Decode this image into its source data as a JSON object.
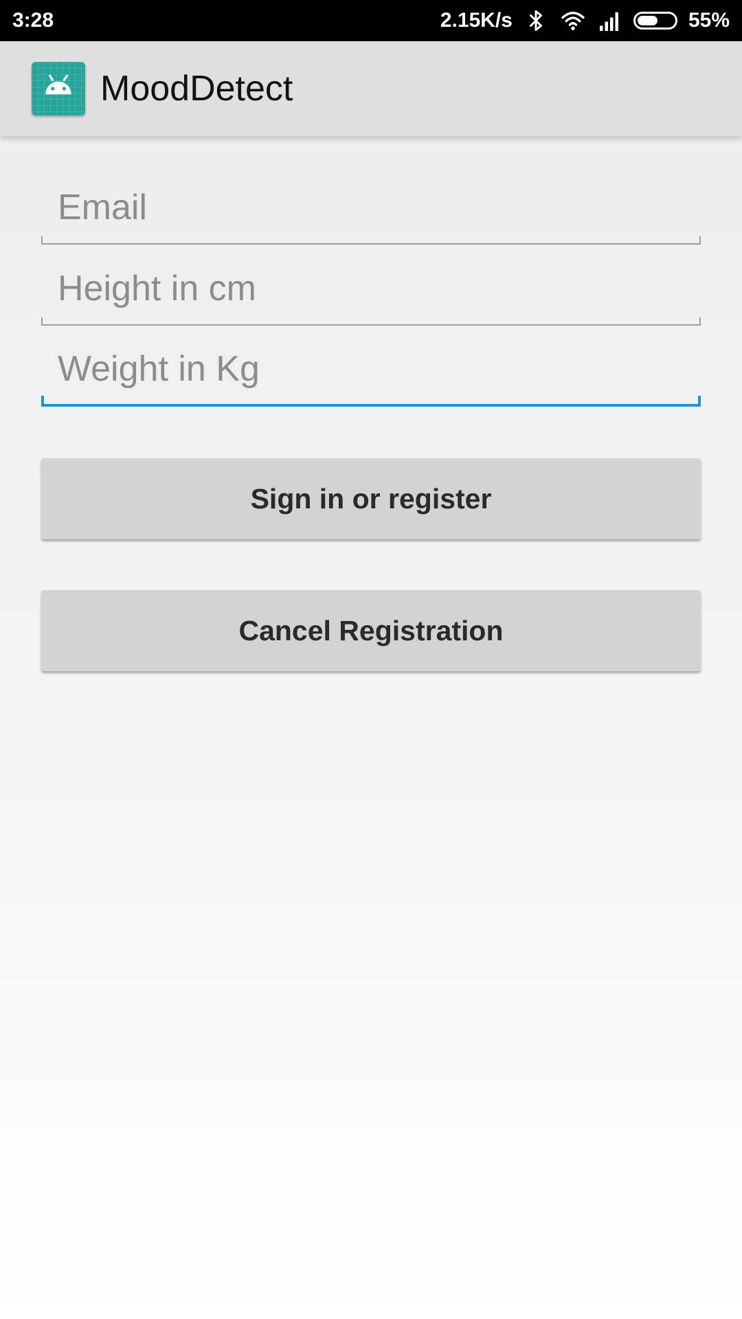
{
  "status_bar": {
    "time": "3:28",
    "network_speed": "2.15K/s",
    "battery_percent": "55%",
    "battery_level": 0.55,
    "icons": [
      "bluetooth-icon",
      "wifi-icon",
      "signal-icon",
      "battery-icon"
    ]
  },
  "app_bar": {
    "title": "MoodDetect",
    "icon": "android-icon",
    "icon_color": "#26a69a"
  },
  "form": {
    "email": {
      "value": "",
      "placeholder": "Email"
    },
    "height": {
      "value": "",
      "placeholder": "Height in cm"
    },
    "weight": {
      "value": "",
      "placeholder": "Weight in Kg",
      "focused": true
    },
    "focus_color": "#1e98d3"
  },
  "buttons": {
    "sign_in": "Sign in or register",
    "cancel": "Cancel Registration"
  }
}
